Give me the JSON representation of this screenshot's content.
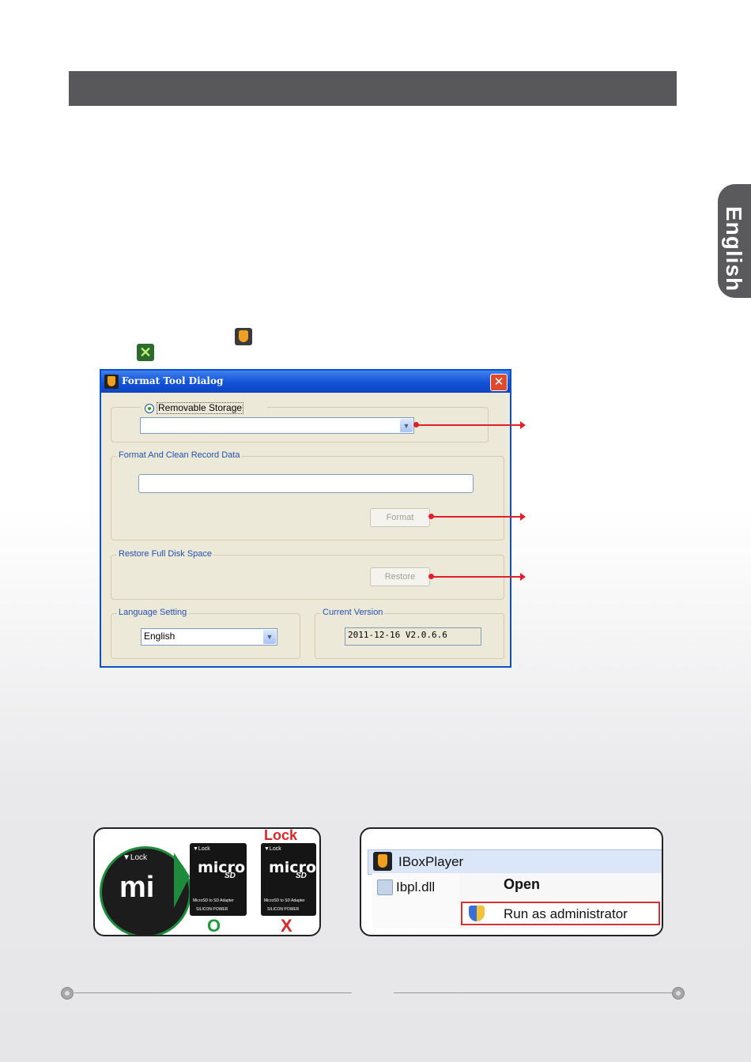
{
  "side_tab": {
    "label": "English"
  },
  "dialog": {
    "title": "Format Tool Dialog",
    "close_glyph": "✕",
    "removable_storage_label": "Removable Storage",
    "format_group_label": "Format And Clean Record Data",
    "format_button": "Format",
    "restore_group_label": "Restore Full Disk Space",
    "restore_button": "Restore",
    "language_group_label": "Language Setting",
    "language_value": "English",
    "version_group_label": "Current Version",
    "version_value": "2011-12-16 V2.0.6.6"
  },
  "card_image": {
    "zoom_lock": "▼Lock",
    "zoom_micro": "mi",
    "card_lock": "▼Lock",
    "card_micro": "micro",
    "card_sd": "SD",
    "card_adapter": "MicroSD to SD Adapter",
    "card_brand": "SILICON POWER",
    "lock_heading": "Lock",
    "ok_mark": "O",
    "ng_mark": "X"
  },
  "context_menu": {
    "app_name": "IBoxPlayer",
    "file_name": "Ibpl.dll",
    "open": "Open",
    "run_as_admin": "Run as administrator"
  },
  "colors": {
    "accent_red": "#e0202a",
    "header_gray": "#58585a",
    "xp_blue": "#1452d6"
  }
}
